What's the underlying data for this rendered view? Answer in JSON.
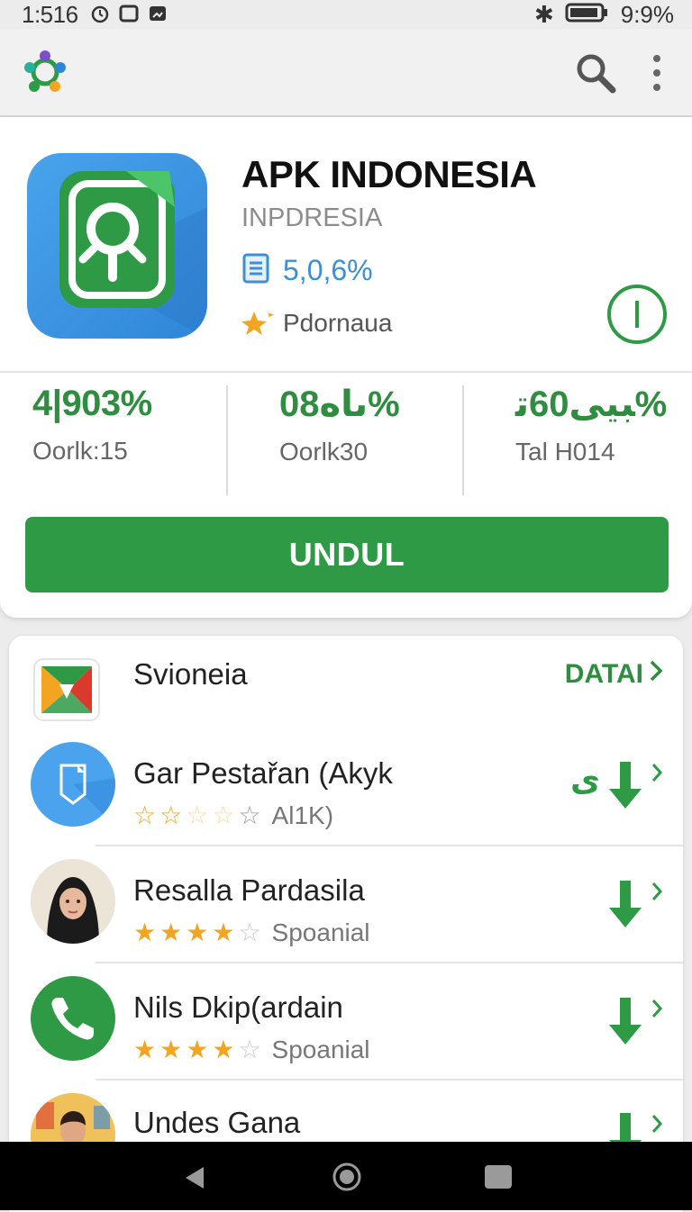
{
  "status_bar": {
    "time": "1:516",
    "battery": "9:9%"
  },
  "app": {
    "title": "APK INDONESIA",
    "subtitle": "INPDRESIA",
    "size": "5,0,6%",
    "category": "Pdornaua"
  },
  "stats": [
    {
      "value": "4|903%",
      "label": "Oorlk:15"
    },
    {
      "value": "ىاه08%",
      "label": "Oorlk30"
    },
    {
      "value": "ت‎بيى60%",
      "label": "Tal H014"
    }
  ],
  "install_label": "UNDUL",
  "list": {
    "header_title": "Svioneia",
    "detail_label": "DATAI",
    "items": [
      {
        "title": "Gar Pestařan (Akyk",
        "rating": 2,
        "meta": "Al1K)",
        "action_prefix": "ى"
      },
      {
        "title": "Resalla Pardasila",
        "rating": 4,
        "meta": "Spoanial"
      },
      {
        "title": "Nils Dkip(ardain",
        "rating": 4,
        "meta": "Spoanial"
      },
      {
        "title": "Undes Gana"
      }
    ]
  },
  "colors": {
    "accent_green": "#2e9a46",
    "link_blue": "#3b8fd4",
    "star": "#f3a521"
  }
}
